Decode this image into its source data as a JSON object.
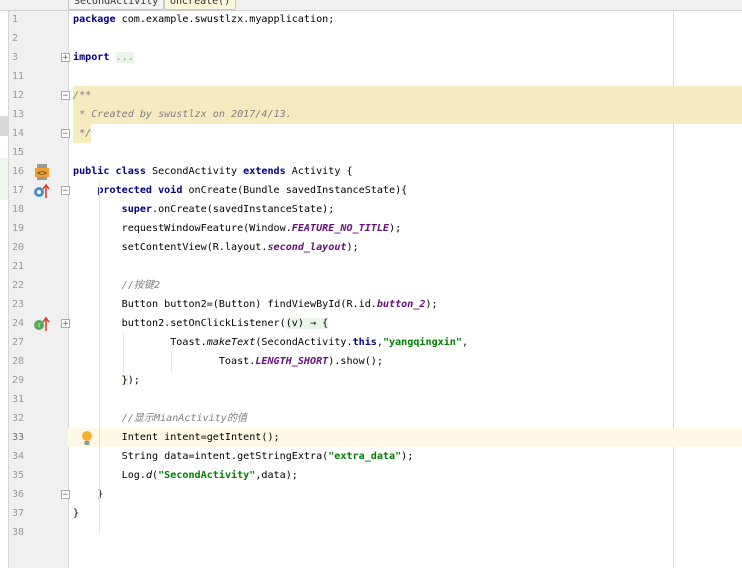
{
  "tabs": [
    {
      "label": "SecondActivity"
    },
    {
      "label": "onCreate()"
    }
  ],
  "colors": {
    "keyword": "#000080",
    "string": "#008000",
    "field": "#660e7a",
    "comment": "#808080",
    "comment_bg": "#f5eac0",
    "current_line": "#fdf9e6"
  },
  "lines": [
    {
      "n": "1",
      "seg": [
        [
          "package",
          "kw"
        ],
        [
          " com.example.swustlzx.myapplication;",
          ""
        ]
      ]
    },
    {
      "n": "2",
      "seg": []
    },
    {
      "n": "3",
      "fold": "plus",
      "seg": [
        [
          "import",
          "kw"
        ],
        [
          " ",
          ""
        ],
        [
          "...",
          "fold"
        ]
      ]
    },
    {
      "n": "11",
      "seg": []
    },
    {
      "n": "12",
      "fold": "minus",
      "comment_bg": "full",
      "seg": [
        [
          "/**",
          "cmt"
        ]
      ]
    },
    {
      "n": "13",
      "comment_bg": "full",
      "seg": [
        [
          " * Created by swustlzx on 2017/4/13.",
          "cmt"
        ]
      ]
    },
    {
      "n": "14",
      "fold": "minus",
      "comment_bg": "short",
      "seg": [
        [
          " */",
          "cmt"
        ]
      ]
    },
    {
      "n": "15",
      "seg": []
    },
    {
      "n": "16",
      "icon": "activity-layout-icon",
      "seg": [
        [
          "public class",
          "kw"
        ],
        [
          " SecondActivity ",
          ""
        ],
        [
          "extends",
          "kw"
        ],
        [
          " Activity {",
          ""
        ]
      ]
    },
    {
      "n": "17",
      "icon": "override-method-icon",
      "fold": "minus",
      "seg": [
        [
          "    ",
          ""
        ],
        [
          "protected void",
          "kw"
        ],
        [
          " onCreate(Bundle savedInstanceState){",
          ""
        ]
      ]
    },
    {
      "n": "18",
      "seg": [
        [
          "        ",
          ""
        ],
        [
          "super",
          "kw"
        ],
        [
          ".onCreate(savedInstanceState);",
          ""
        ]
      ]
    },
    {
      "n": "19",
      "seg": [
        [
          "        requestWindowFeature(Window.",
          ""
        ],
        [
          "FEATURE_NO_TITLE",
          "fld"
        ],
        [
          ");",
          ""
        ]
      ]
    },
    {
      "n": "20",
      "seg": [
        [
          "        setContentView(R.layout.",
          ""
        ],
        [
          "second_layout",
          "fld"
        ],
        [
          ");",
          ""
        ]
      ]
    },
    {
      "n": "21",
      "seg": []
    },
    {
      "n": "22",
      "seg": [
        [
          "        //按键2",
          "cmt"
        ]
      ]
    },
    {
      "n": "23",
      "seg": [
        [
          "        Button button2=(Button) findViewById(R.id.",
          ""
        ],
        [
          "button_2",
          "fld"
        ],
        [
          ");",
          ""
        ]
      ]
    },
    {
      "n": "24",
      "icon": "implement-interface-icon",
      "fold": "plus",
      "seg": [
        [
          "        button2.setOnClickListener(",
          ""
        ],
        [
          "(v) → {",
          "lam"
        ]
      ]
    },
    {
      "n": "27",
      "seg": [
        [
          "                Toast.",
          ""
        ],
        [
          "makeText",
          "it"
        ],
        [
          "(SecondActivity.",
          ""
        ],
        [
          "this",
          "kw"
        ],
        [
          ",",
          ""
        ],
        [
          "\"yangqingxin\"",
          "str"
        ],
        [
          ",",
          ""
        ]
      ]
    },
    {
      "n": "28",
      "seg": [
        [
          "                        Toast.",
          ""
        ],
        [
          "LENGTH_SHORT",
          "fld"
        ],
        [
          ").show();",
          ""
        ]
      ]
    },
    {
      "n": "29",
      "seg": [
        [
          "        ",
          ""
        ],
        [
          "}",
          "lam"
        ],
        [
          ");",
          ""
        ]
      ]
    },
    {
      "n": "31",
      "seg": []
    },
    {
      "n": "32",
      "seg": [
        [
          "        //显示MianActivity的值",
          "cmt"
        ]
      ]
    },
    {
      "n": "33",
      "current": true,
      "icon": "lightbulb-icon",
      "seg": [
        [
          "        Intent intent=getIntent();",
          ""
        ]
      ]
    },
    {
      "n": "34",
      "seg": [
        [
          "        String data=intent.getStringExtra(",
          ""
        ],
        [
          "\"extra_data\"",
          "str"
        ],
        [
          ");",
          ""
        ]
      ]
    },
    {
      "n": "35",
      "seg": [
        [
          "        Log.",
          ""
        ],
        [
          "d",
          "it"
        ],
        [
          "(",
          ""
        ],
        [
          "\"SecondActivity\"",
          "str"
        ],
        [
          ",data);",
          ""
        ]
      ]
    },
    {
      "n": "36",
      "fold": "minus",
      "seg": [
        [
          "    }",
          ""
        ]
      ]
    },
    {
      "n": "37",
      "seg": [
        [
          "}",
          ""
        ]
      ]
    },
    {
      "n": "38",
      "seg": []
    }
  ]
}
